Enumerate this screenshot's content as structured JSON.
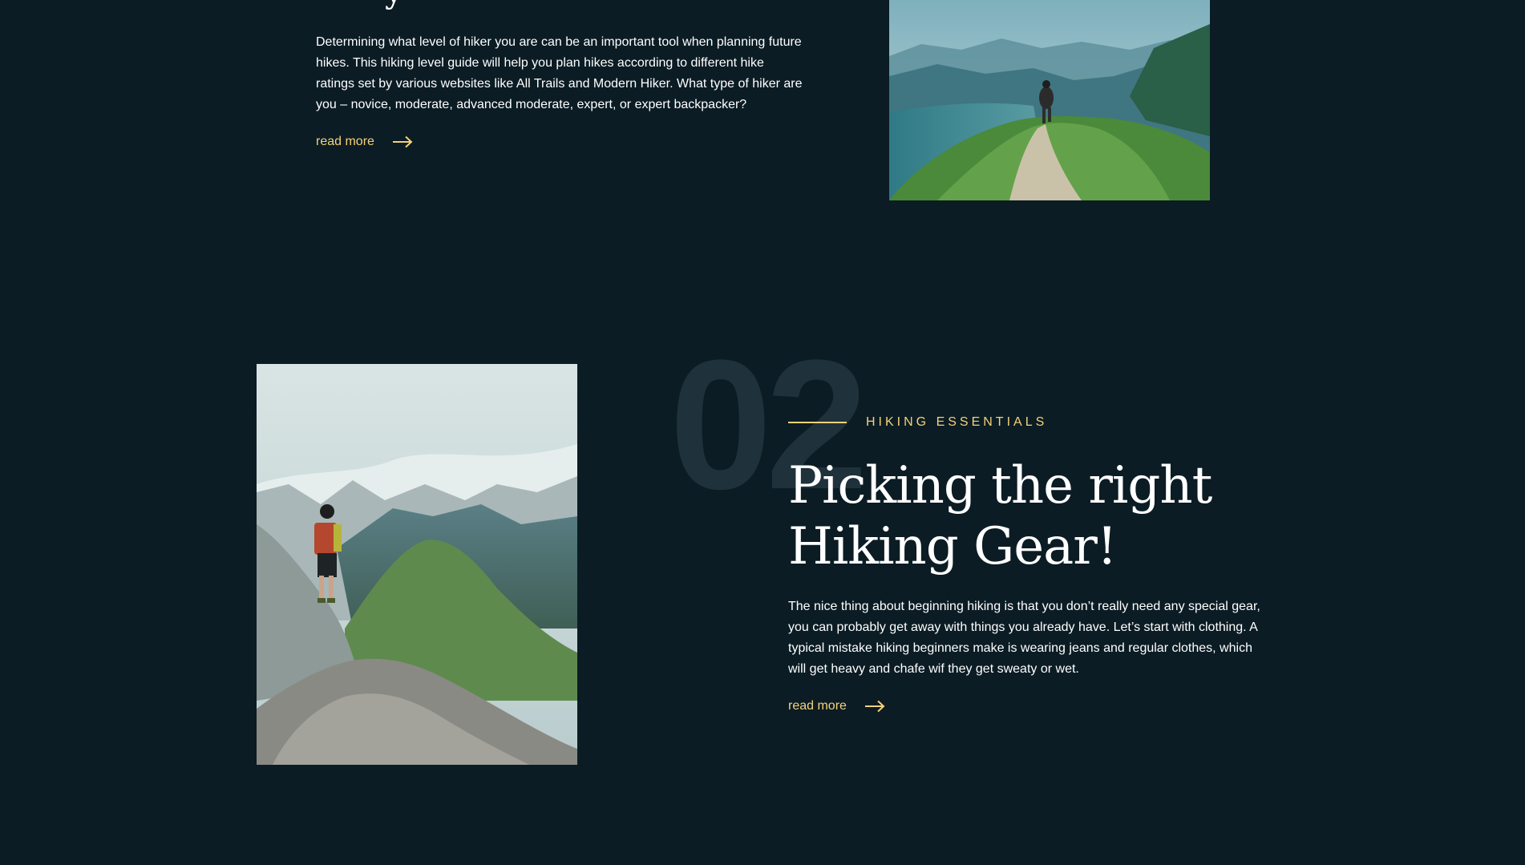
{
  "section1": {
    "title_tail": "y",
    "body": "Determining what level of hiker you are can be an important tool when planning future hikes. This hiking level guide will help you plan hikes according to different hike ratings set by various websites like All Trails and Modern Hiker. What type of hiker are you – novice, moderate, advanced moderate, expert, or expert backpacker?",
    "read_more": "read more",
    "image_icon": "hiker-on-ridge-trail-photo"
  },
  "section2": {
    "number": "02",
    "eyebrow": "HIKING ESSENTIALS",
    "title_line1": "Picking the right",
    "title_line2": "Hiking Gear!",
    "body": "The nice thing about beginning hiking is that you don’t really need any special gear, you can probably get away with things you already have. Let’s start with clothing. A typical mistake hiking beginners make is wearing jeans and regular clothes, which will get heavy and chafe wif they get sweaty or wet.",
    "read_more": "read more",
    "image_icon": "hiker-on-summit-rock-photo"
  },
  "colors": {
    "background": "#0b1c24",
    "accent": "#f5d27a",
    "number_ghost": "#1f313a",
    "text": "#ffffff"
  }
}
